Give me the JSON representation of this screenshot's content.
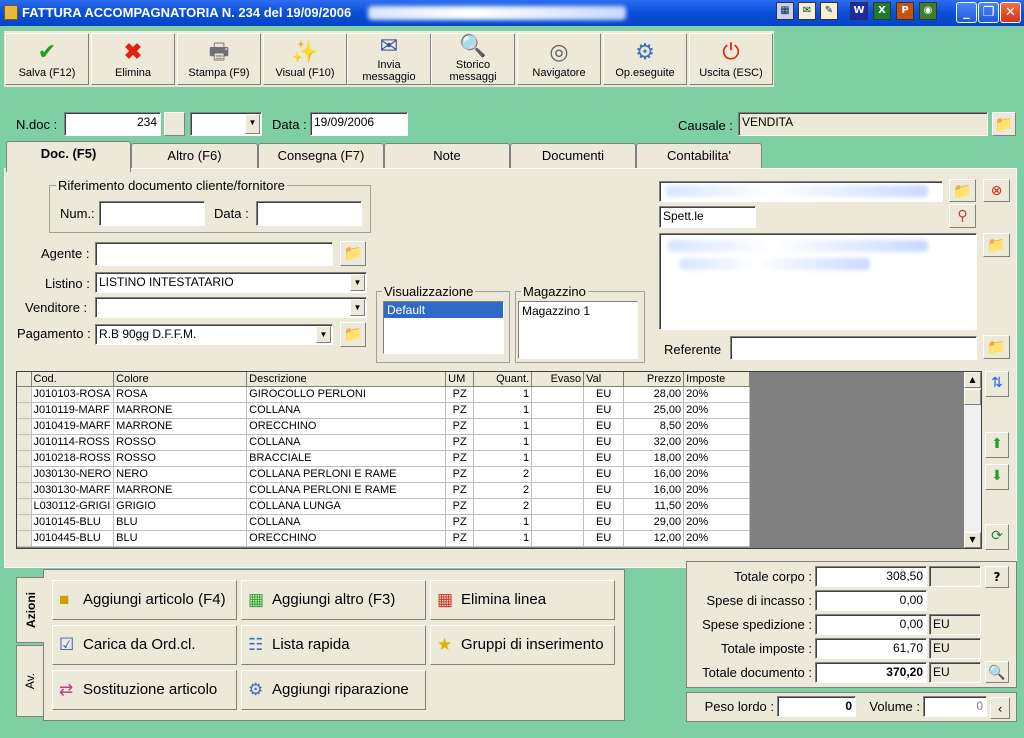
{
  "window": {
    "title": "FATTURA ACCOMPAGNATORIA N. 234  del 19/09/2006"
  },
  "tray": [
    "W",
    "X",
    "P"
  ],
  "toolbar": [
    {
      "label1": "Salva (F12)",
      "label2": "",
      "icon": "check-icon"
    },
    {
      "label1": "Elimina",
      "label2": "",
      "icon": "delete-icon"
    },
    {
      "label1": "Stampa (F9)",
      "label2": "",
      "icon": "printer-icon"
    },
    {
      "label1": "Visual (F10)",
      "label2": "",
      "icon": "magic-wand-icon"
    },
    {
      "label1": "Invia",
      "label2": "messaggio",
      "icon": "send-message-icon"
    },
    {
      "label1": "Storico",
      "label2": "messaggi",
      "icon": "message-history-icon"
    },
    {
      "label1": "Navigatore",
      "label2": "",
      "icon": "compass-icon"
    },
    {
      "label1": "Op.eseguite",
      "label2": "",
      "icon": "gears-icon"
    },
    {
      "label1": "Uscita (ESC)",
      "label2": "",
      "icon": "exit-icon"
    }
  ],
  "header": {
    "ndoc_label": "N.doc :",
    "ndoc_value": "234",
    "data_label": "Data :",
    "data_value": "19/09/2006",
    "causale_label": "Causale :",
    "causale_value": "VENDITA"
  },
  "tabs": [
    "Doc. (F5)",
    "Altro (F6)",
    "Consegna (F7)",
    "Note",
    "Documenti",
    "Contabilita'"
  ],
  "doc": {
    "rif_title": "Riferimento documento cliente/fornitore",
    "num_label": "Num.:",
    "num_value": "",
    "data_label": "Data :",
    "data_value": "",
    "agente_label": "Agente :",
    "agente_value": "",
    "listino_label": "Listino :",
    "listino_value": "LISTINO INTESTATARIO",
    "venditore_label": "Venditore :",
    "venditore_value": "",
    "pagamento_label": "Pagamento :",
    "pagamento_value": "R.B 90gg D.F.F.M.",
    "visual_title": "Visualizzazione",
    "visual_items": [
      "Default"
    ],
    "magazzino_title": "Magazzino",
    "magazzino_items": [
      "Magazzino 1"
    ],
    "spett": "Spett.le",
    "referente_label": "Referente",
    "referente_value": ""
  },
  "grid": {
    "headers": [
      "Cod.",
      "Colore",
      "Descrizione",
      "UM",
      "Quant.",
      "Evaso",
      "Val",
      "Prezzo",
      "Imposte"
    ],
    "rows": [
      [
        "J010103-ROSA",
        "ROSA",
        "GIROCOLLO PERLONI",
        "PZ",
        "1",
        "",
        "EU",
        "28,00",
        "20%"
      ],
      [
        "J010119-MARF",
        "MARRONE",
        "COLLANA",
        "PZ",
        "1",
        "",
        "EU",
        "25,00",
        "20%"
      ],
      [
        "J010419-MARF",
        "MARRONE",
        "ORECCHINO",
        "PZ",
        "1",
        "",
        "EU",
        "8,50",
        "20%"
      ],
      [
        "J010114-ROSS",
        "ROSSO",
        "COLLANA",
        "PZ",
        "1",
        "",
        "EU",
        "32,00",
        "20%"
      ],
      [
        "J010218-ROSS",
        "ROSSO",
        "BRACCIALE",
        "PZ",
        "1",
        "",
        "EU",
        "18,00",
        "20%"
      ],
      [
        "J030130-NERO",
        "NERO",
        "COLLANA PERLONI E RAME",
        "PZ",
        "2",
        "",
        "EU",
        "16,00",
        "20%"
      ],
      [
        "J030130-MARF",
        "MARRONE",
        "COLLANA PERLONI E RAME",
        "PZ",
        "2",
        "",
        "EU",
        "16,00",
        "20%"
      ],
      [
        "L030112-GRIGI",
        "GRIGIO",
        "COLLANA LUNGA",
        "PZ",
        "2",
        "",
        "EU",
        "11,50",
        "20%"
      ],
      [
        "J010145-BLU",
        "BLU",
        "COLLANA",
        "PZ",
        "1",
        "",
        "EU",
        "29,00",
        "20%"
      ],
      [
        "J010445-BLU",
        "BLU",
        "ORECCHINO",
        "PZ",
        "1",
        "",
        "EU",
        "12,00",
        "20%"
      ]
    ]
  },
  "actions": {
    "tab_azioni": "Azioni",
    "tab_av": "Av.",
    "buttons": [
      {
        "label": "Aggiungi articolo (F4)",
        "icon": "add-article-icon"
      },
      {
        "label": "Aggiungi altro (F3)",
        "icon": "add-other-icon"
      },
      {
        "label": "Elimina linea",
        "icon": "delete-row-icon"
      },
      {
        "label": "Carica da Ord.cl.",
        "icon": "load-order-icon"
      },
      {
        "label": "Lista rapida",
        "icon": "quick-list-icon"
      },
      {
        "label": "Gruppi di inserimento",
        "icon": "star-icon"
      },
      {
        "label": "Sostituzione articolo",
        "icon": "replace-icon"
      },
      {
        "label": "Aggiungi riparazione",
        "icon": "repair-icon"
      }
    ]
  },
  "totals": {
    "corpo_label": "Totale corpo :",
    "corpo_value": "308,50",
    "corpo_unit": "",
    "incasso_label": "Spese di incasso :",
    "incasso_value": "0,00",
    "incasso_unit": "",
    "spedizione_label": "Spese spedizione :",
    "spedizione_value": "0,00",
    "spedizione_unit": "EU",
    "imposte_label": "Totale imposte :",
    "imposte_value": "61,70",
    "imposte_unit": "EU",
    "documento_label": "Totale documento :",
    "documento_value": "370,20",
    "documento_unit": "EU",
    "help": "?",
    "peso_label": "Peso lordo :",
    "peso_value": "0",
    "volume_label": "Volume :",
    "volume_value": "0"
  }
}
